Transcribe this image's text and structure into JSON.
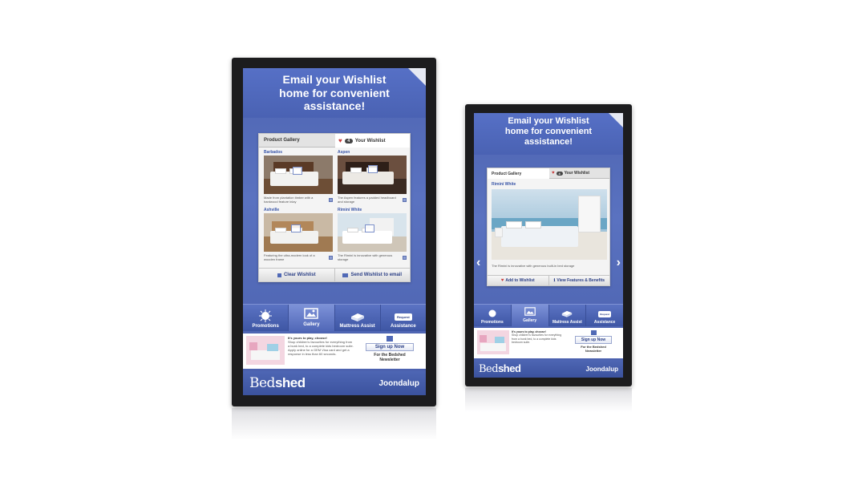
{
  "colors": {
    "screen_blue": "#5068b8",
    "accent_dark": "#2b3f86",
    "heart_red": "#c93b3b"
  },
  "large": {
    "headline": [
      "Email your Wishlist",
      "home for convenient",
      "assistance!"
    ],
    "tabs": {
      "gallery": "Product Gallery",
      "wishlist": "Your Wishlist",
      "count": "4"
    },
    "items": [
      {
        "title": "Barbados",
        "desc": "Made from plantation timber with a hardwood feature inlay"
      },
      {
        "title": "Aspen",
        "desc": "The Aspen features a padded headboard and storage"
      },
      {
        "title": "Ashville",
        "desc": "Featuring the ultra-modern look of a wooden frame"
      },
      {
        "title": "Rimini White",
        "desc": "The Rimini is innovative with generous storage"
      }
    ],
    "footer_buttons": {
      "clear": "Clear Wishlist",
      "send": "Send Wishlist to email"
    },
    "nav": [
      "Promotions",
      "Gallery",
      "Mattress Assist",
      "Assistance"
    ],
    "nav_icons": [
      "sun-icon",
      "gallery-icon",
      "bed-icon",
      "speech-bubble-icon"
    ],
    "nav_bubble": "Request",
    "promo": {
      "headline": "It's yours to play, choose!",
      "body": "Shop children's favourites for everything from a bunk bed, to a complete kids bedroom suite. Apply online for a GEM Visa card and get a response in less than 60 seconds.",
      "signup": "Sign up Now",
      "newsletter": "For the Bedshed Newsletter"
    },
    "brand_light": "Bed",
    "brand_bold": "shed",
    "store": "Joondalup"
  },
  "small": {
    "headline": [
      "Email your Wishlist",
      "home for convenient",
      "assistance!"
    ],
    "tabs": {
      "gallery": "Product Gallery",
      "wishlist": "Your Wishlist",
      "count": "4"
    },
    "product_title": "Rimini White",
    "product_desc": "The Rimini is innovative with generous built-in bed storage",
    "footer_buttons": {
      "add": "Add to Wishlist",
      "features": "View Features & Benefits"
    },
    "nav": [
      "Promotions",
      "Gallery",
      "Mattress Assist",
      "Assistance"
    ],
    "nav_icons": [
      "sun-icon",
      "gallery-icon",
      "bed-icon",
      "speech-bubble-icon"
    ],
    "nav_bubble": "Request",
    "promo": {
      "headline": "It's yours to play, choose!",
      "body": "Shop children's favourites for everything from a bunk bed, to a complete kids bedroom suite.",
      "signup": "Sign up Now",
      "newsletter": "For the Bedshed Newsletter"
    },
    "brand_light": "Bed",
    "brand_bold": "shed",
    "store": "Joondalup",
    "arrows": {
      "prev": "‹",
      "next": "›"
    }
  }
}
